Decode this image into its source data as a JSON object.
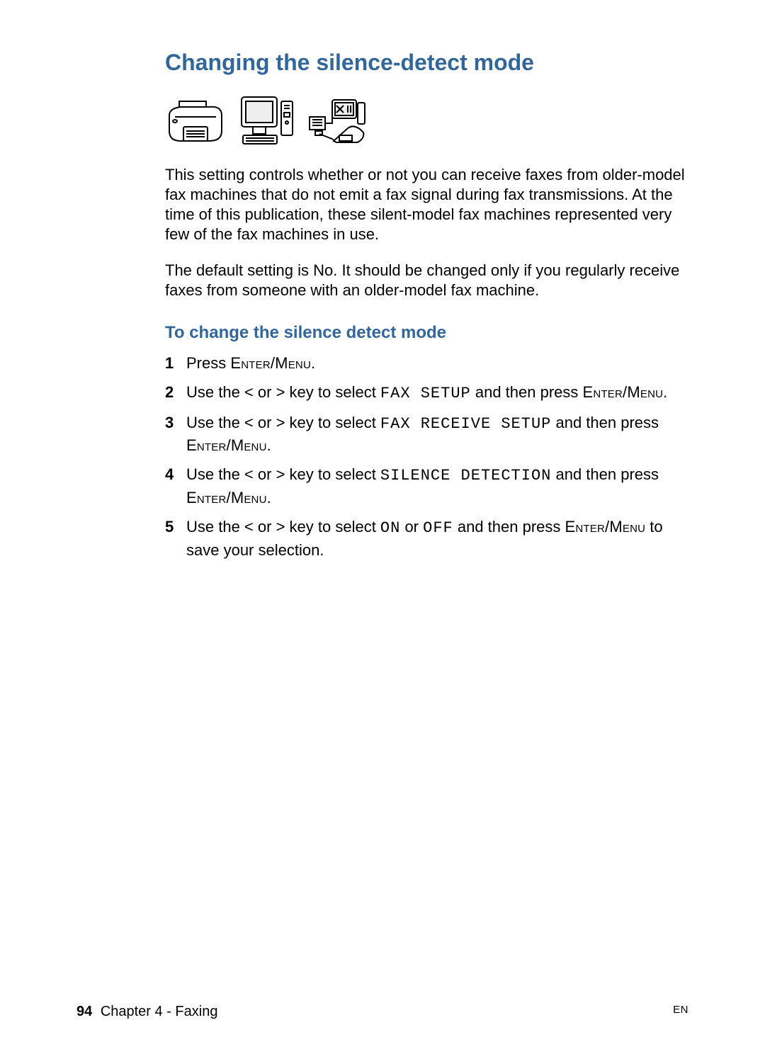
{
  "heading1": "Changing the silence-detect mode",
  "paragraph1": "This setting controls whether or not you can receive faxes from older-model fax machines that do not emit a fax signal during fax transmissions. At the time of this publication, these silent-model fax machines represented very few of the fax machines in use.",
  "paragraph2": "The default setting is No. It should be changed only if you regularly receive faxes from someone with an older-model fax machine.",
  "heading2": "To change the silence detect mode",
  "steps": [
    {
      "num": "1",
      "parts": [
        {
          "t": "text",
          "v": "Press "
        },
        {
          "t": "cap",
          "v": "Enter/Menu"
        },
        {
          "t": "text",
          "v": "."
        }
      ]
    },
    {
      "num": "2",
      "parts": [
        {
          "t": "text",
          "v": "Use the < or > key to select "
        },
        {
          "t": "mono",
          "v": "FAX SETUP"
        },
        {
          "t": "text",
          "v": " and then press "
        },
        {
          "t": "cap",
          "v": "Enter/Menu"
        },
        {
          "t": "text",
          "v": "."
        }
      ]
    },
    {
      "num": "3",
      "parts": [
        {
          "t": "text",
          "v": "Use the < or > key to select "
        },
        {
          "t": "mono",
          "v": "FAX RECEIVE SETUP"
        },
        {
          "t": "text",
          "v": " and then press "
        },
        {
          "t": "cap",
          "v": "Enter/Menu"
        },
        {
          "t": "text",
          "v": "."
        }
      ]
    },
    {
      "num": "4",
      "parts": [
        {
          "t": "text",
          "v": "Use the < or > key to select "
        },
        {
          "t": "mono",
          "v": "SILENCE DETECTION"
        },
        {
          "t": "text",
          "v": " and then press "
        },
        {
          "t": "cap",
          "v": "Enter/Menu"
        },
        {
          "t": "text",
          "v": "."
        }
      ]
    },
    {
      "num": "5",
      "parts": [
        {
          "t": "text",
          "v": "Use the < or > key to select "
        },
        {
          "t": "mono",
          "v": "ON"
        },
        {
          "t": "text",
          "v": " or "
        },
        {
          "t": "mono",
          "v": "OFF"
        },
        {
          "t": "text",
          "v": " and then press "
        },
        {
          "t": "cap",
          "v": "Enter/Menu"
        },
        {
          "t": "text",
          "v": " to save your selection."
        }
      ]
    }
  ],
  "footer": {
    "page": "94",
    "chapter": "Chapter 4 - Faxing",
    "lang": "EN"
  }
}
